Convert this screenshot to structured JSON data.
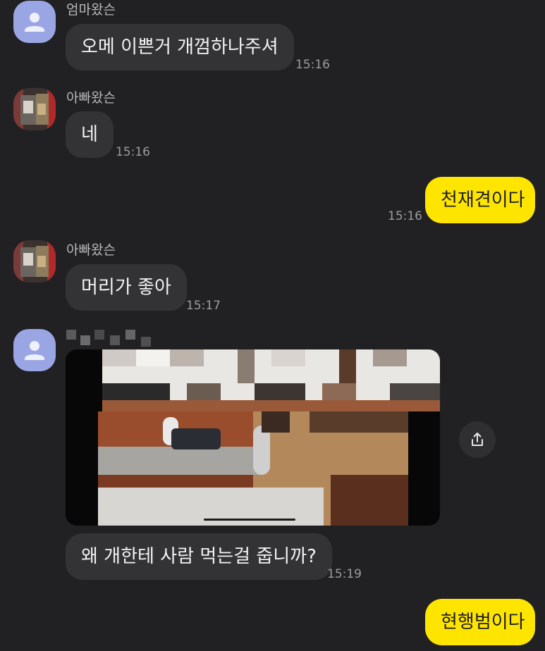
{
  "chat": {
    "messages": [
      {
        "sender": "엄마왔슨",
        "text": "오메 이쁜거 개껌하나주셔",
        "time": "15:16"
      },
      {
        "sender": "아빠왔슨",
        "text": "네",
        "time": "15:16"
      },
      {
        "text": "천재견이다",
        "time": "15:16",
        "mine": true
      },
      {
        "sender": "아빠왔슨",
        "text": "머리가 좋아",
        "time": "15:17"
      },
      {
        "text": "왜 개한테 사람 먹는걸 줍니까?",
        "time": "15:19"
      },
      {
        "text": "현행범이다",
        "mine": true
      }
    ]
  },
  "icons": {
    "default_avatar": "person-icon",
    "share": "share-icon"
  },
  "colors": {
    "background": "#212123",
    "my_bubble": "#fee500",
    "other_bubble": "#333336",
    "default_avatar": "#9aa6e4"
  }
}
